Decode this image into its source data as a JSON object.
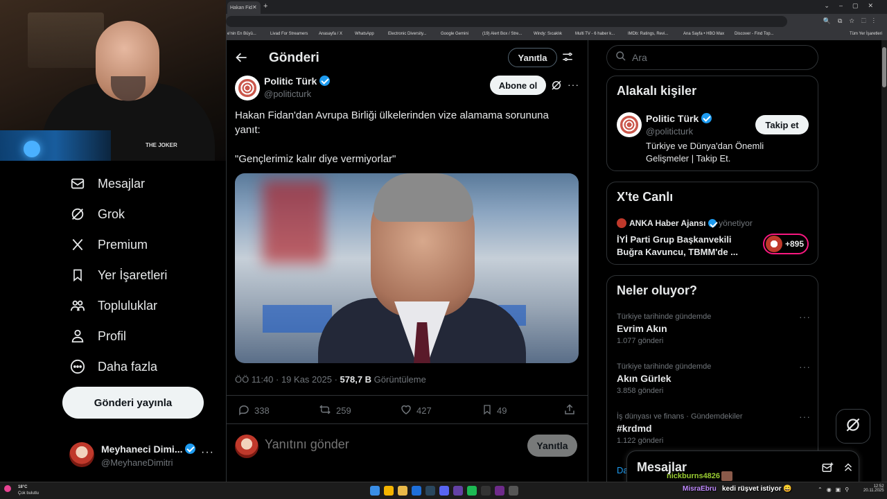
{
  "browser": {
    "tab_title": "Hakan Fid",
    "bookmarks": [
      "e'nin En Büyü...",
      "Livad For Streamers",
      "Anasayfa / X",
      "WhatsApp",
      "Electronic Diversity...",
      "Google Gemini",
      "(19) Alert Box / Stre...",
      "Windy: Sıcaklık",
      "Multi TV - 6 haber k...",
      "IMDb: Ratings, Revi...",
      "Ana Sayfa • HBO Max",
      "Discover - Find Top...",
      "Tüm Yer İşaretleri"
    ]
  },
  "webcam": {
    "logo_text": "THE JOKER"
  },
  "nav": {
    "items": [
      {
        "label": "Mesajlar",
        "icon": "mail-icon"
      },
      {
        "label": "Grok",
        "icon": "grok-icon"
      },
      {
        "label": "Premium",
        "icon": "x-logo-icon"
      },
      {
        "label": "Yer İşaretleri",
        "icon": "bookmark-icon"
      },
      {
        "label": "Topluluklar",
        "icon": "communities-icon"
      },
      {
        "label": "Profil",
        "icon": "person-icon"
      },
      {
        "label": "Daha fazla",
        "icon": "more-circle-icon"
      }
    ],
    "post_button": "Gönderi yayınla",
    "account": {
      "name": "Meyhaneci Dimi...",
      "handle": "@MeyhaneDimitri",
      "avatar_text": "DİMİTRİ"
    }
  },
  "main": {
    "title": "Gönderi",
    "reply_top": "Yanıtla",
    "author": {
      "name": "Politic Türk",
      "handle": "@politicturk"
    },
    "subscribe": "Abone ol",
    "text_line1": "Hakan Fidan'dan Avrupa Birliği ülkelerinden vize alamama sorununa yanıt:",
    "text_line2": "\"Gençlerimiz kalır diye vermiyorlar\"",
    "meta_time": "ÖÖ 11:40 · 19 Kas 2025 · ",
    "meta_views": "578,7 B",
    "meta_views_label": " Görüntüleme",
    "actions": {
      "replies": "338",
      "reposts": "259",
      "likes": "427",
      "bookmarks": "49"
    },
    "reply_placeholder": "Yanıtını gönder",
    "reply_button": "Yanıtla"
  },
  "sidebar": {
    "search_placeholder": "Ara",
    "related": {
      "title": "Alakalı kişiler",
      "name": "Politic Türk",
      "handle": "@politicturk",
      "bio": "Türkiye ve Dünya'dan Önemli Gelişmeler | Takip Et.",
      "follow": "Takip et"
    },
    "live": {
      "title": "X'te Canlı",
      "host": "ANKA Haber Ajansı",
      "host_role": "yönetiyor",
      "headline": "İYİ Parti Grup Başkanvekili Buğra Kavuncu, TBMM'de ...",
      "count": "+895"
    },
    "trends": {
      "title": "Neler oluyor?",
      "items": [
        {
          "category": "Türkiye tarihinde gündemde",
          "name": "Evrim Akın",
          "count": "1.077 gönderi"
        },
        {
          "category": "Türkiye tarihinde gündemde",
          "name": "Akın Gürlek",
          "count": "3.858 gönderi"
        },
        {
          "category": "İş dünyası ve finans · Gündemdekiler",
          "name": "#krdmd",
          "count": "1.122 gönderi"
        }
      ],
      "partial": "Da"
    },
    "messages_drawer": "Mesajlar"
  },
  "chat_overlay": [
    {
      "user": "nickburns4826",
      "message": ""
    },
    {
      "user": "MisraEbru",
      "message": "kedi rüşvet istiyor 😄"
    }
  ],
  "taskbar": {
    "weather_temp": "18°C",
    "weather_desc": "Çok bulutlu",
    "time": "12:52",
    "date": "20.11.2025"
  },
  "colors": {
    "accent": "#1d9bf0",
    "background": "#000000",
    "chat_user_1": "#9acd32",
    "chat_user_2": "#c08aff"
  }
}
